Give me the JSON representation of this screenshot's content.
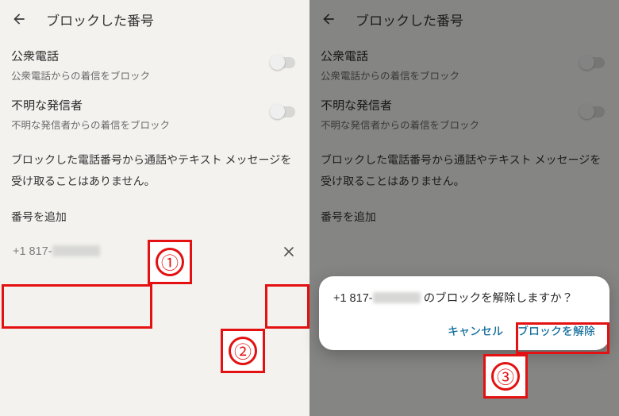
{
  "header": {
    "title": "ブロックした番号"
  },
  "payphone": {
    "title": "公衆電話",
    "sub": "公衆電話からの着信をブロック"
  },
  "unknown": {
    "title": "不明な発信者",
    "sub": "不明な発信者からの着信をブロック"
  },
  "info": "ブロックした電話番号から通話やテキスト メッセージを受け取ることはありません。",
  "add_label": "番号を追加",
  "number_prefix": "+1 817-",
  "dialog": {
    "prefix": "+1 817-",
    "suffix": " のブロックを解除しますか？",
    "cancel": "キャンセル",
    "confirm": "ブロックを解除"
  },
  "anno": {
    "n1": "①",
    "n2": "②",
    "n3": "③"
  }
}
